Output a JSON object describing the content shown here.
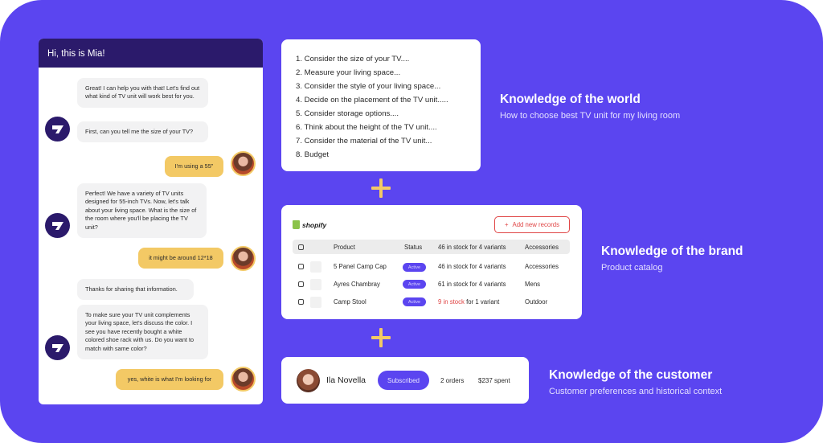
{
  "colors": {
    "background": "#5b45f0",
    "chat_header": "#2b1a6b",
    "user_bubble": "#f3c965",
    "plus": "#f3c965",
    "alert_red": "#e04646"
  },
  "chat": {
    "header_title": "Hi, this is Mia!",
    "messages": [
      {
        "sender": "bot",
        "text": "Great! I can help you with that! Let's find out what kind of TV unit will work best for you."
      },
      {
        "sender": "bot",
        "text": "First, can you tell me the size of your TV?"
      },
      {
        "sender": "user",
        "text": "I'm using a 55\""
      },
      {
        "sender": "bot",
        "text": "Perfect! We have a variety of TV units designed for 55-inch TVs. Now, let's talk about your living space. What is the size of the room where you'll be placing the TV unit?"
      },
      {
        "sender": "user",
        "text": "it might be around 12*18"
      },
      {
        "sender": "bot",
        "text": "Thanks for sharing that information."
      },
      {
        "sender": "bot",
        "text": "To make sure your TV unit complements your living space, let's discuss the color. I see you have recently bought a white colored shoe rack with us. Do you want to match with same color?"
      },
      {
        "sender": "user",
        "text": "yes, white is what I'm looking for"
      }
    ]
  },
  "world": {
    "items": [
      "1. Consider the size of your TV....",
      "2. Measure your living space...",
      "3. Consider the style of your living space...",
      "4. Decide on the placement of the TV unit.....",
      "5. Consider storage options....",
      "6. Think about the height of the TV unit....",
      "7. Consider the material of the TV unit...",
      "8. Budget"
    ],
    "title": "Knowledge of the world",
    "subtitle": "How to choose best TV unit for my living room"
  },
  "brand": {
    "logo_text": "shopify",
    "add_button": "Add new records",
    "add_icon": "+",
    "headers": [
      "Product",
      "Status",
      "46 in stock for 4 variants",
      "Accessories"
    ],
    "rows": [
      {
        "product": "5 Panel Camp Cap",
        "status": "Active",
        "stock_highlight": "",
        "stock": "46 in stock for 4 variants",
        "category": "Accessories"
      },
      {
        "product": "Ayres Chambray",
        "status": "Active",
        "stock_highlight": "",
        "stock": "61 in stock for 4 variants",
        "category": "Mens"
      },
      {
        "product": "Camp Stool",
        "status": "Active",
        "stock_highlight": "9 in stock",
        "stock": " for 1 variant",
        "category": "Outdoor"
      }
    ],
    "title": "Knowledge of the brand",
    "subtitle": "Product catalog"
  },
  "customer": {
    "name": "Ila Novella",
    "status": "Subscribed",
    "orders": "2 orders",
    "spent": "$237 spent",
    "title": "Knowledge of the customer",
    "subtitle": "Customer preferences and historical context"
  }
}
